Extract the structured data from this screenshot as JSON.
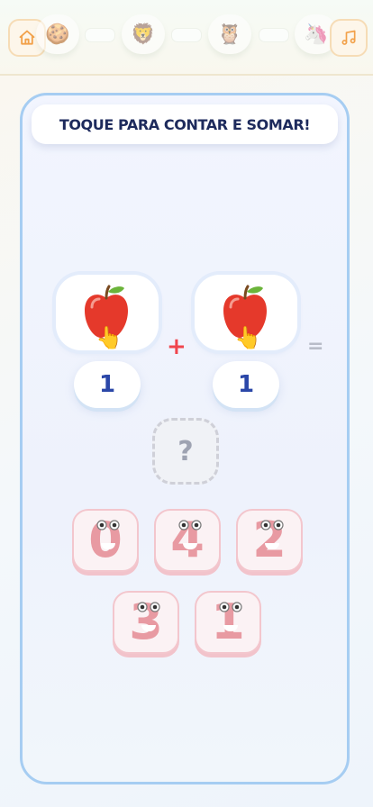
{
  "topbar": {
    "home_icon": "home-icon",
    "music_icon": "music-note-icon",
    "levels": [
      {
        "emoji": "🍪",
        "name": "cookie"
      },
      {
        "emoji": "🦁",
        "name": "lion"
      },
      {
        "emoji": "🦉",
        "name": "owl"
      },
      {
        "emoji": "🦄",
        "name": "unicorn"
      }
    ],
    "accent": "#f2a14a"
  },
  "game": {
    "instruction": "TOQUE PARA CONTAR E SOMAR!",
    "operator": "+",
    "equals": "=",
    "answer_placeholder": "?",
    "left_count": "1",
    "right_count": "1",
    "left_item": "apple",
    "right_item": "apple",
    "pointer_icon": "👆"
  },
  "choices": [
    {
      "label": "0"
    },
    {
      "label": "4"
    },
    {
      "label": "2"
    },
    {
      "label": "3"
    },
    {
      "label": "1"
    }
  ],
  "colors": {
    "card_border": "#a6cdf2",
    "number_blue": "#2b47a8",
    "plus_red": "#f0454d",
    "tile_pink": "#e89aa2"
  }
}
